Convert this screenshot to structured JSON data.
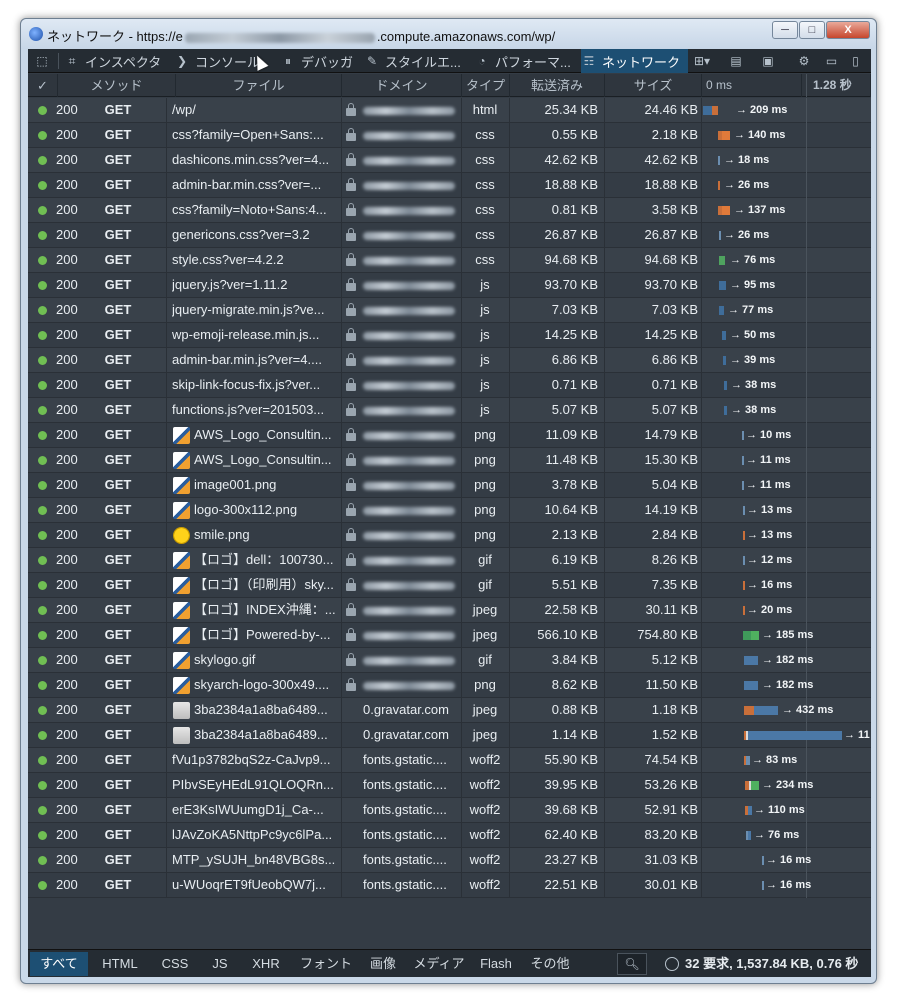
{
  "window": {
    "title_prefix": "ネットワーク - https://e",
    "title_suffix": ".compute.amazonaws.com/wp/",
    "buttons": [
      "─",
      "□",
      "X"
    ]
  },
  "toolbar": {
    "tools": [
      {
        "name": "element-picker",
        "label": "",
        "icon": "cursor-icon"
      },
      {
        "name": "inspector",
        "label": "インスペクタ",
        "icon": "inspector-icon"
      },
      {
        "name": "console",
        "label": "コンソール",
        "icon": "console-icon"
      },
      {
        "name": "debugger",
        "label": "デバッガ",
        "icon": "debugger-icon"
      },
      {
        "name": "style-editor",
        "label": "スタイルエ...",
        "icon": "pencil-icon"
      },
      {
        "name": "performance",
        "label": "パフォーマ...",
        "icon": "gauge-icon"
      },
      {
        "name": "network",
        "label": "ネットワーク",
        "icon": "network-icon",
        "active": true
      }
    ]
  },
  "columns": {
    "status": "✓",
    "method": "メソッド",
    "file": "ファイル",
    "domain": "ドメイン",
    "type": "タイプ",
    "transferred": "転送済み",
    "size": "サイズ",
    "wf_start": "0 ms",
    "wf_end": "1.28 秒"
  },
  "requests": [
    {
      "status": "200",
      "method": "GET",
      "file": "/wp/",
      "domain": "",
      "type": "html",
      "transferred": "25.34 KB",
      "size": "24.46 KB",
      "timing": "→ 209 ms"
    },
    {
      "status": "200",
      "method": "GET",
      "file": "css?family=Open+Sans:...",
      "domain": "",
      "type": "css",
      "transferred": "0.55 KB",
      "size": "2.18 KB",
      "timing": "→ 140 ms"
    },
    {
      "status": "200",
      "method": "GET",
      "file": "dashicons.min.css?ver=4...",
      "domain": "",
      "type": "css",
      "transferred": "42.62 KB",
      "size": "42.62 KB",
      "timing": "→ 18 ms"
    },
    {
      "status": "200",
      "method": "GET",
      "file": "admin-bar.min.css?ver=...",
      "domain": "",
      "type": "css",
      "transferred": "18.88 KB",
      "size": "18.88 KB",
      "timing": "→ 26 ms"
    },
    {
      "status": "200",
      "method": "GET",
      "file": "css?family=Noto+Sans:4...",
      "domain": "",
      "type": "css",
      "transferred": "0.81 KB",
      "size": "3.58 KB",
      "timing": "→ 137 ms"
    },
    {
      "status": "200",
      "method": "GET",
      "file": "genericons.css?ver=3.2",
      "domain": "",
      "type": "css",
      "transferred": "26.87 KB",
      "size": "26.87 KB",
      "timing": "→ 26 ms"
    },
    {
      "status": "200",
      "method": "GET",
      "file": "style.css?ver=4.2.2",
      "domain": "",
      "type": "css",
      "transferred": "94.68 KB",
      "size": "94.68 KB",
      "timing": "→ 76 ms"
    },
    {
      "status": "200",
      "method": "GET",
      "file": "jquery.js?ver=1.11.2",
      "domain": "",
      "type": "js",
      "transferred": "93.70 KB",
      "size": "93.70 KB",
      "timing": "→ 95 ms"
    },
    {
      "status": "200",
      "method": "GET",
      "file": "jquery-migrate.min.js?ve...",
      "domain": "",
      "type": "js",
      "transferred": "7.03 KB",
      "size": "7.03 KB",
      "timing": "→ 77 ms"
    },
    {
      "status": "200",
      "method": "GET",
      "file": "wp-emoji-release.min.js...",
      "domain": "",
      "type": "js",
      "transferred": "14.25 KB",
      "size": "14.25 KB",
      "timing": "→ 50 ms"
    },
    {
      "status": "200",
      "method": "GET",
      "file": "admin-bar.min.js?ver=4....",
      "domain": "",
      "type": "js",
      "transferred": "6.86 KB",
      "size": "6.86 KB",
      "timing": "→ 39 ms"
    },
    {
      "status": "200",
      "method": "GET",
      "file": "skip-link-focus-fix.js?ver...",
      "domain": "",
      "type": "js",
      "transferred": "0.71 KB",
      "size": "0.71 KB",
      "timing": "→ 38 ms"
    },
    {
      "status": "200",
      "method": "GET",
      "file": "functions.js?ver=201503...",
      "domain": "",
      "type": "js",
      "transferred": "5.07 KB",
      "size": "5.07 KB",
      "timing": "→ 38 ms"
    },
    {
      "status": "200",
      "method": "GET",
      "file": "AWS_Logo_Consultin...",
      "domain": "",
      "type": "png",
      "transferred": "11.09 KB",
      "size": "14.79 KB",
      "timing": "→ 10 ms",
      "thumb": "image-thumbnail"
    },
    {
      "status": "200",
      "method": "GET",
      "file": "AWS_Logo_Consultin...",
      "domain": "",
      "type": "png",
      "transferred": "11.48 KB",
      "size": "15.30 KB",
      "timing": "→ 11 ms",
      "thumb": "image-thumbnail"
    },
    {
      "status": "200",
      "method": "GET",
      "file": "image001.png",
      "domain": "",
      "type": "png",
      "transferred": "3.78 KB",
      "size": "5.04 KB",
      "timing": "→ 11 ms",
      "thumb": "image-thumbnail"
    },
    {
      "status": "200",
      "method": "GET",
      "file": "logo-300x112.png",
      "domain": "",
      "type": "png",
      "transferred": "10.64 KB",
      "size": "14.19 KB",
      "timing": "→ 13 ms",
      "thumb": "image-thumbnail"
    },
    {
      "status": "200",
      "method": "GET",
      "file": "smile.png",
      "domain": "",
      "type": "png",
      "transferred": "2.13 KB",
      "size": "2.84 KB",
      "timing": "→ 13 ms",
      "thumb": "smiley-thumbnail"
    },
    {
      "status": "200",
      "method": "GET",
      "file": "【ロゴ】dell：100730...",
      "domain": "",
      "type": "gif",
      "transferred": "6.19 KB",
      "size": "8.26 KB",
      "timing": "→ 12 ms",
      "thumb": "image-thumbnail"
    },
    {
      "status": "200",
      "method": "GET",
      "file": "【ロゴ】（印刷用）sky...",
      "domain": "",
      "type": "gif",
      "transferred": "5.51 KB",
      "size": "7.35 KB",
      "timing": "→ 16 ms",
      "thumb": "image-thumbnail"
    },
    {
      "status": "200",
      "method": "GET",
      "file": "【ロゴ】INDEX沖縄：...",
      "domain": "",
      "type": "jpeg",
      "transferred": "22.58 KB",
      "size": "30.11 KB",
      "timing": "→ 20 ms",
      "thumb": "image-thumbnail"
    },
    {
      "status": "200",
      "method": "GET",
      "file": "【ロゴ】Powered-by-...",
      "domain": "",
      "type": "jpeg",
      "transferred": "566.10 KB",
      "size": "754.80 KB",
      "timing": "→ 185 ms",
      "thumb": "image-thumbnail"
    },
    {
      "status": "200",
      "method": "GET",
      "file": "skylogo.gif",
      "domain": "",
      "type": "gif",
      "transferred": "3.84 KB",
      "size": "5.12 KB",
      "timing": "→ 182 ms",
      "thumb": "image-thumbnail"
    },
    {
      "status": "200",
      "method": "GET",
      "file": "skyarch-logo-300x49....",
      "domain": "",
      "type": "png",
      "transferred": "8.62 KB",
      "size": "11.50 KB",
      "timing": "→ 182 ms",
      "thumb": "image-thumbnail"
    },
    {
      "status": "200",
      "method": "GET",
      "file": "3ba2384a1a8ba6489...",
      "domain": "0.gravatar.com",
      "type": "jpeg",
      "transferred": "0.88 KB",
      "size": "1.18 KB",
      "timing": "→ 432 ms",
      "thumb": "avatar-thumbnail"
    },
    {
      "status": "200",
      "method": "GET",
      "file": "3ba2384a1a8ba6489...",
      "domain": "0.gravatar.com",
      "type": "jpeg",
      "transferred": "1.14 KB",
      "size": "1.52 KB",
      "timing": "→ 11",
      "thumb": "avatar-thumbnail"
    },
    {
      "status": "200",
      "method": "GET",
      "file": "fVu1p3782bqS2z-CaJvp9...",
      "domain": "fonts.gstatic....",
      "type": "woff2",
      "transferred": "55.90 KB",
      "size": "74.54 KB",
      "timing": "→ 83 ms"
    },
    {
      "status": "200",
      "method": "GET",
      "file": "PIbvSEyHEdL91QLOQRn...",
      "domain": "fonts.gstatic....",
      "type": "woff2",
      "transferred": "39.95 KB",
      "size": "53.26 KB",
      "timing": "→ 234 ms"
    },
    {
      "status": "200",
      "method": "GET",
      "file": "erE3KsIWUumgD1j_Ca-...",
      "domain": "fonts.gstatic....",
      "type": "woff2",
      "transferred": "39.68 KB",
      "size": "52.91 KB",
      "timing": "→ 110 ms"
    },
    {
      "status": "200",
      "method": "GET",
      "file": "lJAvZoKA5NttpPc9yc6lPa...",
      "domain": "fonts.gstatic....",
      "type": "woff2",
      "transferred": "62.40 KB",
      "size": "83.20 KB",
      "timing": "→ 76 ms"
    },
    {
      "status": "200",
      "method": "GET",
      "file": "MTP_ySUJH_bn48VBG8s...",
      "domain": "fonts.gstatic....",
      "type": "woff2",
      "transferred": "23.27 KB",
      "size": "31.03 KB",
      "timing": "→ 16 ms"
    },
    {
      "status": "200",
      "method": "GET",
      "file": "u-WUoqrET9fUeobQW7j...",
      "domain": "fonts.gstatic....",
      "type": "woff2",
      "transferred": "22.51 KB",
      "size": "30.01 KB",
      "timing": "→ 16 ms"
    }
  ],
  "filters": [
    "すべて",
    "HTML",
    "CSS",
    "JS",
    "XHR",
    "フォント",
    "画像",
    "メディア",
    "Flash",
    "その他"
  ],
  "summary": "32 要求, 1,537.84 KB, 0.76 秒",
  "colors": {
    "accent": "#1d4f73",
    "status_ok": "#70bf53",
    "panel_bg": "#343c45",
    "row_alt": "#39414a"
  }
}
